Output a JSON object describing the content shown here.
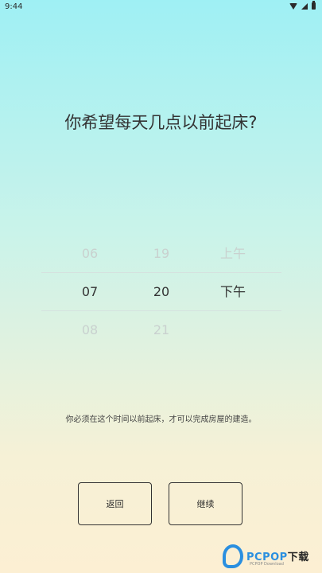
{
  "status_bar": {
    "time": "9:44"
  },
  "title": "你希望每天几点以前起床?",
  "picker": {
    "hours": [
      "06",
      "07",
      "08"
    ],
    "minutes": [
      "19",
      "20",
      "21"
    ],
    "ampm": [
      "上午",
      "下午"
    ]
  },
  "hint": "你必须在这个时间以前起床，才可以完成房屋的建造。",
  "buttons": {
    "back": "返回",
    "continue": "继续"
  },
  "watermark": {
    "brand": "PCPOP",
    "suffix": "下载",
    "sub": "PCPOP Download"
  }
}
